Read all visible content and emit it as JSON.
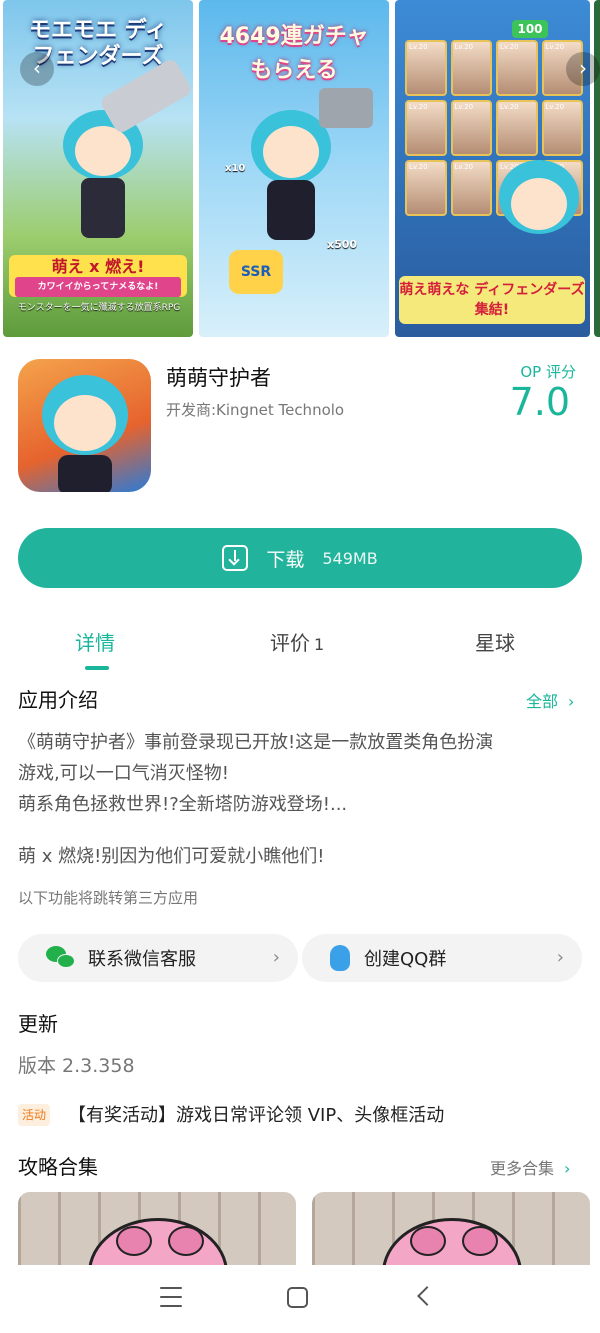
{
  "carousel": {
    "shot1_title": "モエモエ ディフェンダーズ",
    "shot1_banner": "萌え x 燃え!",
    "shot1_banner_sub": "カワイイからってナメるなよ!",
    "shot1_caption": "モンスターを一気に殲滅する放置系RPG",
    "shot2_title_line1": "4649連ガチャ",
    "shot2_title_line2": "もらえる",
    "shot2_ssr": "SSR",
    "shot2_x10": "x10",
    "shot2_x500": "x500",
    "shot3_banner": "萌え萌えな ディフェンダーズ集結!",
    "shot3_battery": "100",
    "card_level": "Lv.20"
  },
  "app": {
    "name": "萌萌守护者",
    "developer": "开发商:Kingnet Technolo",
    "rating_label": "OP 评分",
    "rating_value": "7.0"
  },
  "download": {
    "label": "下载",
    "size": "549MB"
  },
  "tabs": {
    "detail": "详情",
    "review": "评价",
    "review_count": "1",
    "planet": "星球"
  },
  "intro": {
    "title": "应用介绍",
    "all_link": "全部",
    "desc_line1": "《萌萌守护者》事前登录现已开放!这是一款放置类角色扮演",
    "desc_line2": "游戏,可以一口气消灭怪物!",
    "desc_line3": "萌系角色拯救世界!?全新塔防游戏登场!...",
    "desc_line4": "萌 x 燃烧!别因为他们可爱就小瞧他们!",
    "third_party_note": "以下功能将跳转第三方应用"
  },
  "contacts": {
    "wechat_label": "联系微信客服",
    "qq_label": "创建QQ群"
  },
  "update": {
    "title": "更新",
    "version": "版本 2.3.358",
    "event_tag": "活动",
    "event_text": "【有奖活动】游戏日常评论领 VIP、头像框活动"
  },
  "guides": {
    "title": "攻略合集",
    "more_link": "更多合集"
  },
  "icons": {
    "nav": [
      "menu-icon",
      "home-icon",
      "back-icon"
    ]
  },
  "colors": {
    "accent": "#21b39b",
    "event_tag_bg": "#fdeede",
    "event_tag_text": "#f07a1a"
  }
}
